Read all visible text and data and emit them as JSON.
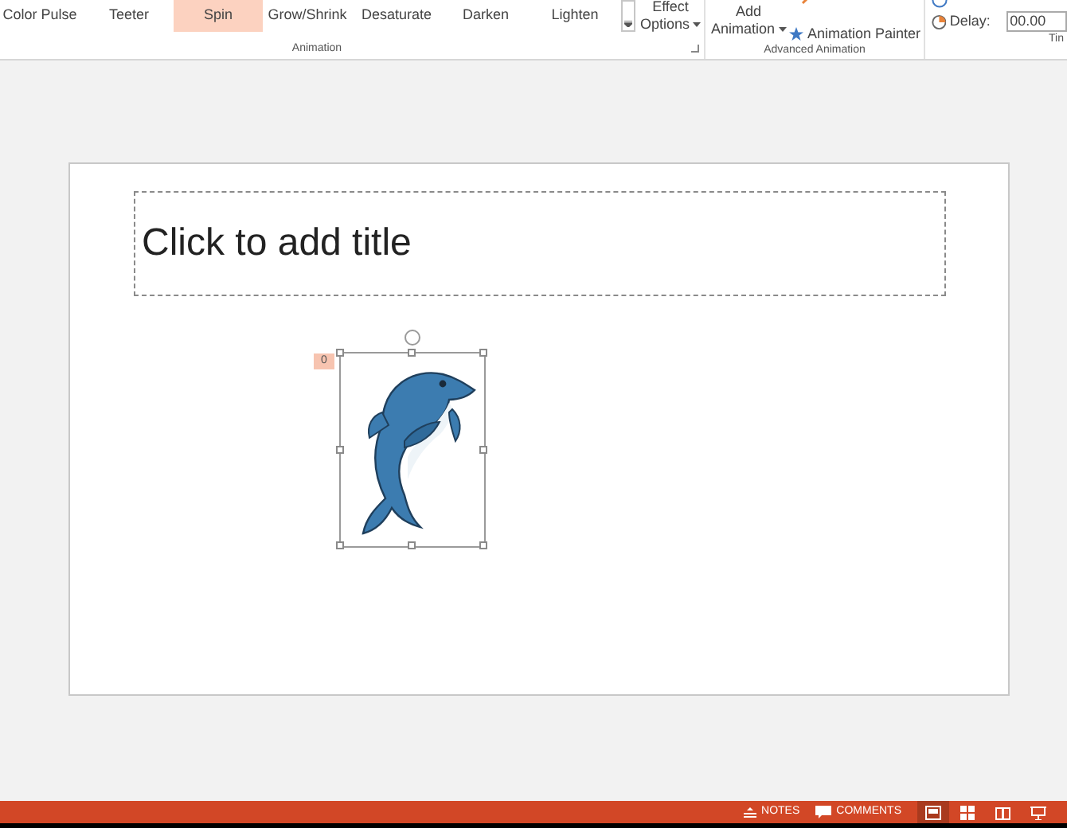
{
  "ribbon": {
    "gallery": [
      {
        "label": "Color Pulse",
        "selected": false
      },
      {
        "label": "Teeter",
        "selected": false
      },
      {
        "label": "Spin",
        "selected": true
      },
      {
        "label": "Grow/Shrink",
        "selected": false
      },
      {
        "label": "Desaturate",
        "selected": false
      },
      {
        "label": "Darken",
        "selected": false
      },
      {
        "label": "Lighten",
        "selected": false
      }
    ],
    "effect_options": [
      "Effect",
      "Options"
    ],
    "add_animation": [
      "Add",
      "Animation"
    ],
    "animation_painter": "Animation Painter",
    "delay_label": "Delay:",
    "delay_value": "00.00",
    "groups": [
      "Animation",
      "Advanced Animation",
      "Tin"
    ]
  },
  "slide": {
    "title_placeholder": "Click to add title",
    "animation_badge": "0"
  },
  "status_bar": {
    "buttons": [
      "NOTES",
      "COMMENTS"
    ],
    "views": [
      {
        "selected": true
      },
      {
        "selected": false
      },
      {
        "selected": false
      },
      {
        "selected": false
      }
    ]
  }
}
